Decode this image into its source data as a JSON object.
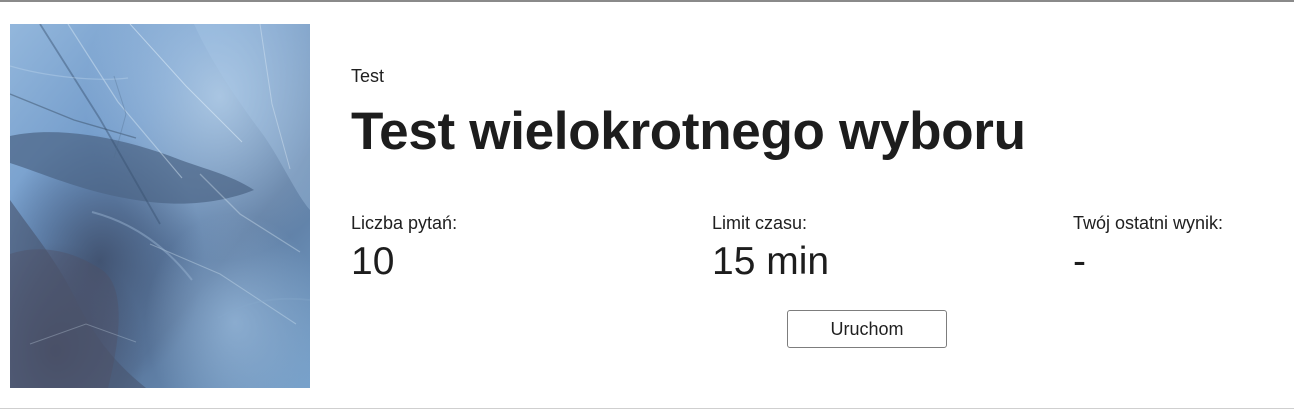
{
  "quiz": {
    "eyebrow": "Test",
    "title": "Test wielokrotnego wyboru",
    "stats": [
      {
        "label": "Liczba pytań:",
        "value": "10"
      },
      {
        "label": "Limit czasu:",
        "value": "15 min"
      },
      {
        "label": "Twój ostatni wynik:",
        "value": "-"
      }
    ],
    "launch_label": "Uruchom"
  },
  "colors": {
    "text": "#1d1d1d",
    "border_top": "#8a8a8a",
    "border_bottom": "#cfcfcf",
    "button_border": "#7d7d7d",
    "thumbnail_blue": "#6f93bd"
  }
}
